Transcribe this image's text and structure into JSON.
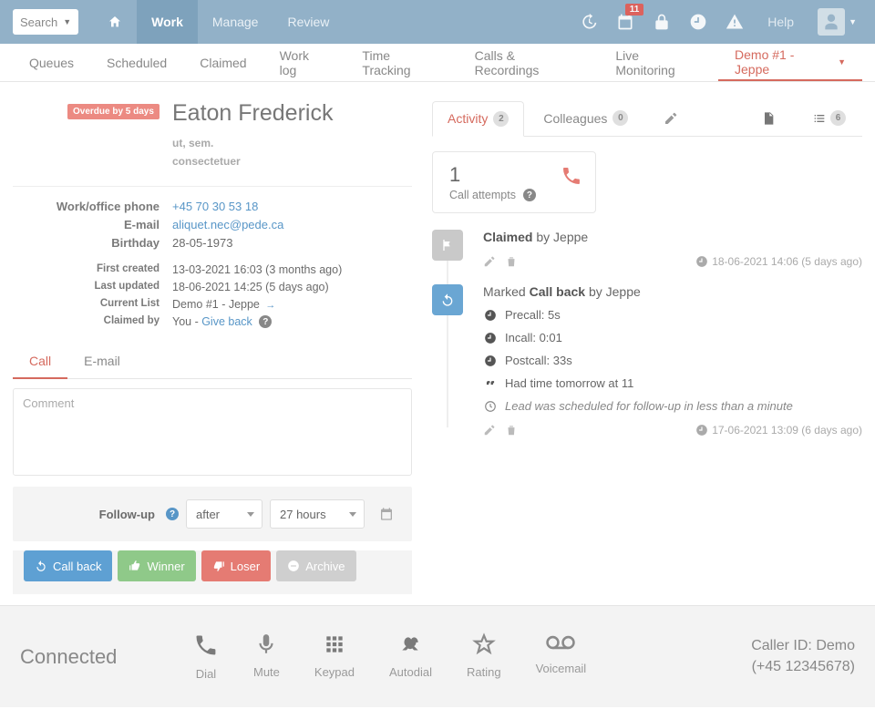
{
  "topbar": {
    "search_label": "Search",
    "nav": {
      "work": "Work",
      "manage": "Manage",
      "review": "Review",
      "help": "Help"
    },
    "calendar_badge": "11"
  },
  "subnav": {
    "queues": "Queues",
    "scheduled": "Scheduled",
    "claimed": "Claimed",
    "worklog": "Work log",
    "timetracking": "Time Tracking",
    "calls": "Calls & Recordings",
    "live": "Live Monitoring",
    "demo": "Demo #1 - Jeppe"
  },
  "lead": {
    "overdue": "Overdue by 5 days",
    "name": "Eaton Frederick",
    "sub1": "ut, sem.",
    "sub2": "consectetuer",
    "fields": {
      "phone_label": "Work/office phone",
      "phone": "+45 70 30 53 18",
      "email_label": "E-mail",
      "email": "aliquet.nec@pede.ca",
      "birthday_label": "Birthday",
      "birthday": "28-05-1973",
      "created_label": "First created",
      "created": "13-03-2021 16:03 (3 months ago)",
      "updated_label": "Last updated",
      "updated": "18-06-2021 14:25 (5 days ago)",
      "list_label": "Current List",
      "list": "Demo #1 - Jeppe",
      "claimed_label": "Claimed by",
      "claimed_prefix": "You - ",
      "giveback": "Give back"
    }
  },
  "compose": {
    "tab_call": "Call",
    "tab_email": "E-mail",
    "comment_placeholder": "Comment",
    "followup_label": "Follow-up",
    "followup_mode": "after",
    "followup_value": "27 hours",
    "btn_callback": "Call back",
    "btn_winner": "Winner",
    "btn_loser": "Loser",
    "btn_archive": "Archive"
  },
  "right": {
    "tabs": {
      "activity": "Activity",
      "activity_count": "2",
      "colleagues": "Colleagues",
      "colleagues_count": "0",
      "list_count": "6"
    },
    "attempts": {
      "num": "1",
      "label": "Call attempts"
    },
    "event1": {
      "prefix": "Claimed",
      "by": " by Jeppe",
      "ts": "18-06-2021 14:06 (5 days ago)"
    },
    "event2": {
      "prefix": "Marked ",
      "bold": "Call back",
      "suffix": " by Jeppe",
      "precall": "Precall: 5s",
      "incall": "Incall: 0:01",
      "postcall": "Postcall: 33s",
      "note": "Had time tomorrow at 11",
      "followup": "Lead was scheduled for follow-up in less than a minute",
      "ts": "17-06-2021 13:09 (6 days ago)"
    }
  },
  "footer": {
    "state": "Connected",
    "dial": "Dial",
    "mute": "Mute",
    "keypad": "Keypad",
    "autodial": "Autodial",
    "rating": "Rating",
    "voicemail": "Voicemail",
    "caller_line1": "Caller ID: Demo",
    "caller_line2": "(+45 12345678)"
  }
}
